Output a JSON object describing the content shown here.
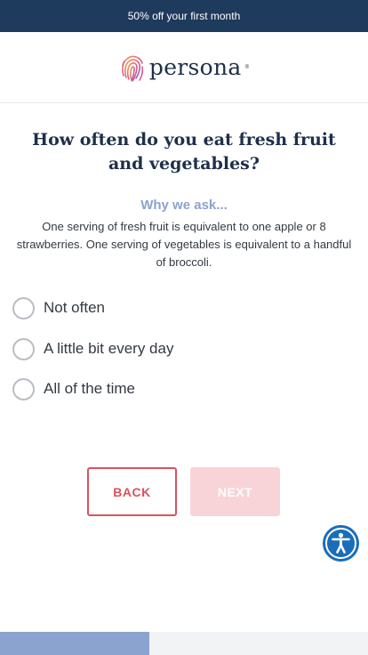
{
  "promo_banner": {
    "text": "50% off your first month"
  },
  "brand": {
    "name": "persona",
    "logo_icon": "fingerprint-icon",
    "trademark": "®"
  },
  "question": {
    "title": "How often do you eat fresh fruit and vegetables?"
  },
  "why": {
    "title": "Why we ask...",
    "text": "One serving of fresh fruit is equivalent to one apple or 8 strawberries. One serving of vegetables is equivalent to a handful of broccoli."
  },
  "options": [
    {
      "label": "Not often",
      "selected": false
    },
    {
      "label": "A little bit every day",
      "selected": false
    },
    {
      "label": "All of the time",
      "selected": false
    }
  ],
  "buttons": {
    "back_label": "BACK",
    "next_label": "NEXT",
    "next_enabled": false
  },
  "accessibility": {
    "icon": "accessibility-icon"
  },
  "progress": {
    "fraction": 0.405
  },
  "colors": {
    "banner": "#1e3a5c",
    "accent_red": "#d9535e",
    "next_disabled": "#f8d4d8",
    "why_title": "#8aa3cf",
    "progress_fill": "#8aa3cf",
    "a11y_blue": "#1a6dba"
  }
}
